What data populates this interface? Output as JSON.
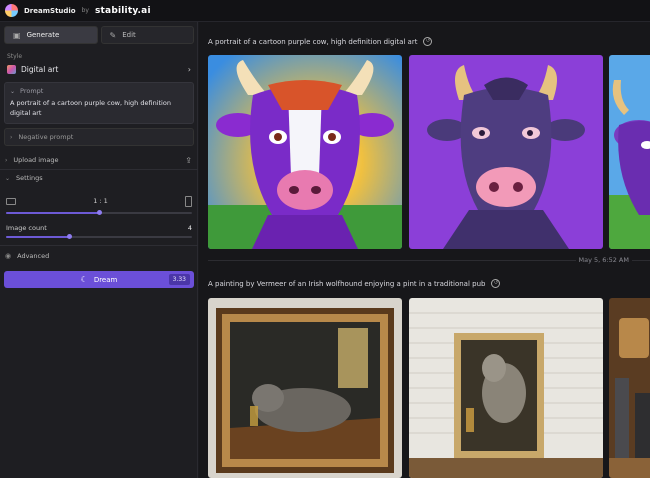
{
  "app": {
    "name": "DreamStudio",
    "by": "by",
    "company": "stability.ai"
  },
  "tabs": [
    {
      "label": "Generate"
    },
    {
      "label": "Edit"
    }
  ],
  "style": {
    "label": "Style",
    "value": "Digital art"
  },
  "prompt": {
    "label": "Prompt",
    "text": "A portrait of a cartoon purple cow, high definition digital art"
  },
  "negative_prompt": {
    "label": "Negative prompt"
  },
  "upload": {
    "label": "Upload image"
  },
  "settings": {
    "label": "Settings",
    "aspect_ratio": "1 : 1",
    "aspect_fraction": 0.5,
    "image_count_label": "Image count",
    "image_count": "4",
    "image_count_fraction": 0.34
  },
  "advanced": {
    "label": "Advanced"
  },
  "dream": {
    "label": "Dream",
    "cost": "3.33"
  },
  "results": [
    {
      "prompt": "A portrait of a cartoon purple cow, high definition digital art"
    },
    {
      "prompt": "A painting by Vermeer of an Irish wolfhound enjoying a pint in a traditional pub"
    }
  ],
  "timestamp": "May 5, 6:52 AM",
  "colors": {
    "accent": "#6b4fd8",
    "background": "#17171a",
    "sidebar": "#1e1e22"
  }
}
